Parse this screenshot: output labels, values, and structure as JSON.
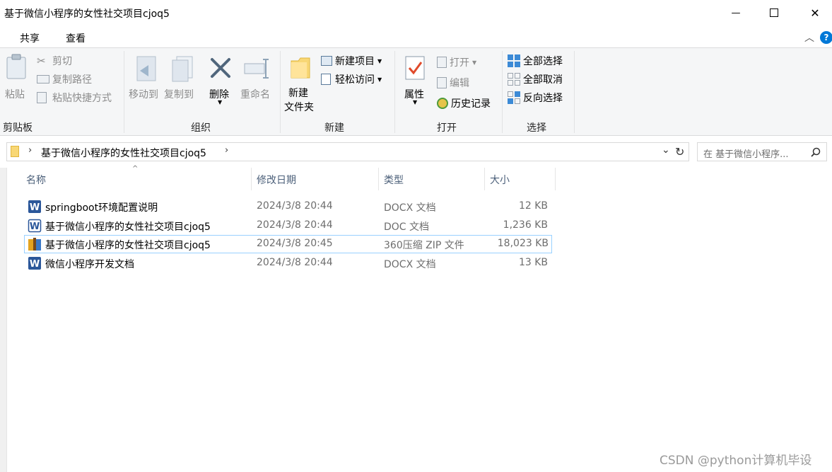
{
  "window": {
    "title": "基于微信小程序的女性社交项目cjoq5",
    "minimize_symbol": "—",
    "maximize_symbol": "☐",
    "close_symbol": "✕"
  },
  "ribbon_tabs": [
    "共享",
    "查看"
  ],
  "ribbon": {
    "clipboard": {
      "group_label": "剪贴板",
      "paste": "粘贴",
      "cut": "剪切",
      "copy_path": "复制路径",
      "paste_shortcut": "粘贴快捷方式"
    },
    "organize": {
      "group_label": "组织",
      "move_to": "移动到",
      "copy_to": "复制到",
      "delete": "删除",
      "rename": "重命名"
    },
    "new": {
      "group_label": "新建",
      "new_folder_line1": "新建",
      "new_folder_line2": "文件夹",
      "new_item": "新建项目",
      "easy_access": "轻松访问"
    },
    "open": {
      "group_label": "打开",
      "properties": "属性",
      "open": "打开",
      "edit": "编辑",
      "history": "历史记录"
    },
    "select": {
      "group_label": "选择",
      "select_all": "全部选择",
      "select_none": "全部取消",
      "invert": "反向选择"
    }
  },
  "address": {
    "breadcrumb": "基于微信小程序的女性社交项目cjoq5",
    "search_placeholder": "在 基于微信小程序..."
  },
  "columns": {
    "name": "名称",
    "date": "修改日期",
    "type": "类型",
    "size": "大小"
  },
  "files": [
    {
      "name": "springboot环境配置说明",
      "date": "2024/3/8 20:44",
      "type": "DOCX 文档",
      "size": "12 KB",
      "icon": "word-doc-icon"
    },
    {
      "name": "基于微信小程序的女性社交项目cjoq5",
      "date": "2024/3/8 20:44",
      "type": "DOC 文档",
      "size": "1,236 KB",
      "icon": "word-doc-outline-icon"
    },
    {
      "name": "基于微信小程序的女性社交项目cjoq5",
      "date": "2024/3/8 20:45",
      "type": "360压缩 ZIP 文件",
      "size": "18,023 KB",
      "icon": "zip-archive-icon"
    },
    {
      "name": "微信小程序开发文档",
      "date": "2024/3/8 20:44",
      "type": "DOCX 文档",
      "size": "13 KB",
      "icon": "word-doc-icon"
    }
  ],
  "watermark": "CSDN @python计算机毕设",
  "colors": {
    "accent": "#0078d7",
    "word_blue": "#2b579a",
    "selection_border": "#99d1ff",
    "header_text": "#4c607a"
  }
}
